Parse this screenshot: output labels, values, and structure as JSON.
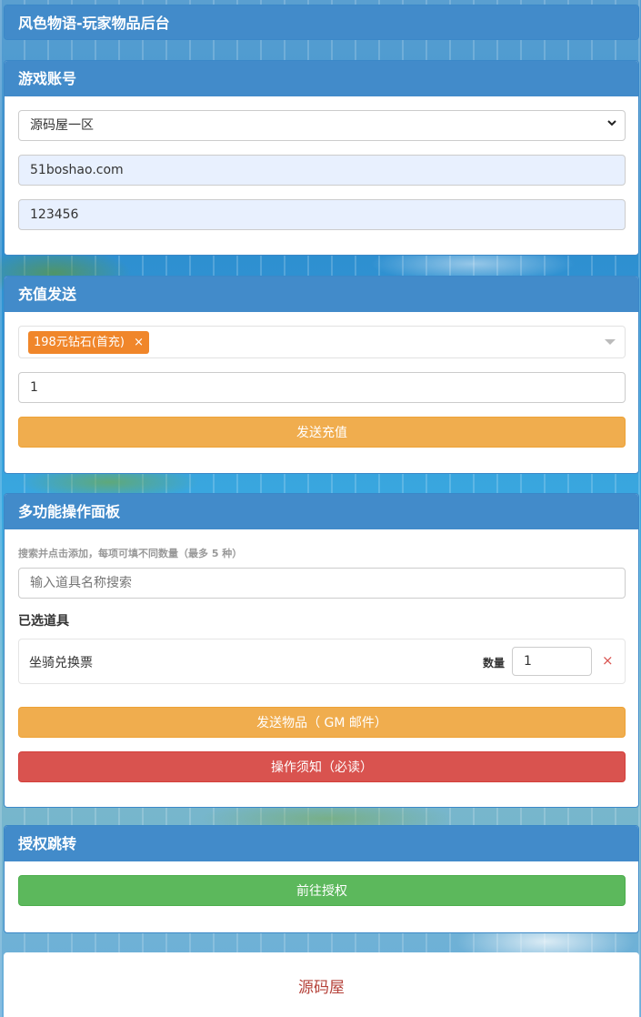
{
  "app_title": "风色物语-玩家物品后台",
  "account": {
    "heading": "游戏账号",
    "server_selected": "源码屋一区",
    "username_value": "51boshao.com",
    "password_value": "123456"
  },
  "recharge": {
    "heading": "充值发送",
    "selected_tag": "198元钻石(首充)",
    "tag_remove": "×",
    "quantity_value": "1",
    "send_label": "发送充值"
  },
  "multi": {
    "heading": "多功能操作面板",
    "hint": "搜索并点击添加，每项可填不同数量（最多 5 种）",
    "search_placeholder": "输入道具名称搜索",
    "selected_title": "已选道具",
    "items": [
      {
        "name": "坐骑兑换票",
        "qty_label": "数量",
        "qty_value": "1",
        "remove": "×"
      }
    ],
    "send_label": "发送物品（ GM 邮件）",
    "notice_label": "操作须知（必读）"
  },
  "auth": {
    "heading": "授权跳转",
    "goto_label": "前往授权"
  },
  "footer": {
    "text": "源码屋"
  },
  "colors": {
    "primary": "#428bca",
    "warning": "#f0ad4e",
    "danger": "#d9534f",
    "success": "#5cb85c",
    "tag": "#f0862a",
    "footer_text": "#b5423a"
  }
}
